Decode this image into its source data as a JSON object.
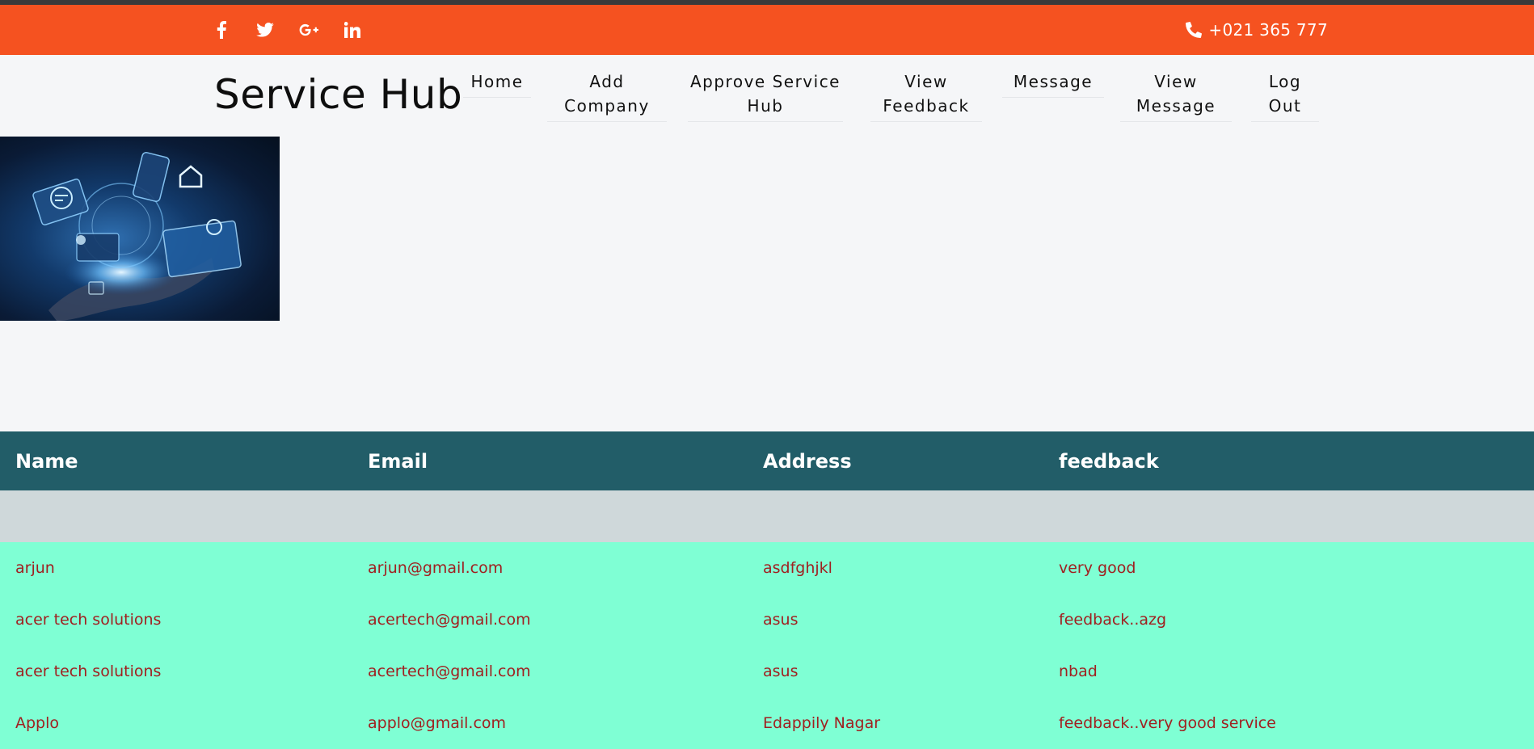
{
  "topbar": {
    "social_icons": [
      "facebook-icon",
      "twitter-icon",
      "google-plus-icon",
      "linkedin-icon"
    ],
    "phone": "+021 365 777",
    "background_color": "#f55220"
  },
  "header": {
    "brand": "Service Hub",
    "nav": [
      {
        "line1": "Home",
        "line2": ""
      },
      {
        "line1": "Add",
        "line2": "Company"
      },
      {
        "line1": "Approve Service",
        "line2": "Hub"
      },
      {
        "line1": "View",
        "line2": "Feedback"
      },
      {
        "line1": "Message",
        "line2": ""
      },
      {
        "line1": "View",
        "line2": "Message"
      },
      {
        "line1": "Log",
        "line2": "Out"
      }
    ]
  },
  "table": {
    "headers": [
      "Name",
      "Email",
      "Address",
      "feedback"
    ],
    "rows": [
      [
        "arjun",
        "arjun@gmail.com",
        "asdfghjkl",
        "very good"
      ],
      [
        "acer tech solutions",
        "acertech@gmail.com",
        "asus",
        "feedback..azg"
      ],
      [
        "acer tech solutions",
        "acertech@gmail.com",
        "asus",
        "nbad"
      ],
      [
        "Applo",
        "applo@gmail.com",
        "Edappily Nagar",
        "feedback..very good service"
      ]
    ],
    "header_color": "#225d68",
    "row_color": "#7fffd4",
    "cell_text_color": "#a02020"
  }
}
